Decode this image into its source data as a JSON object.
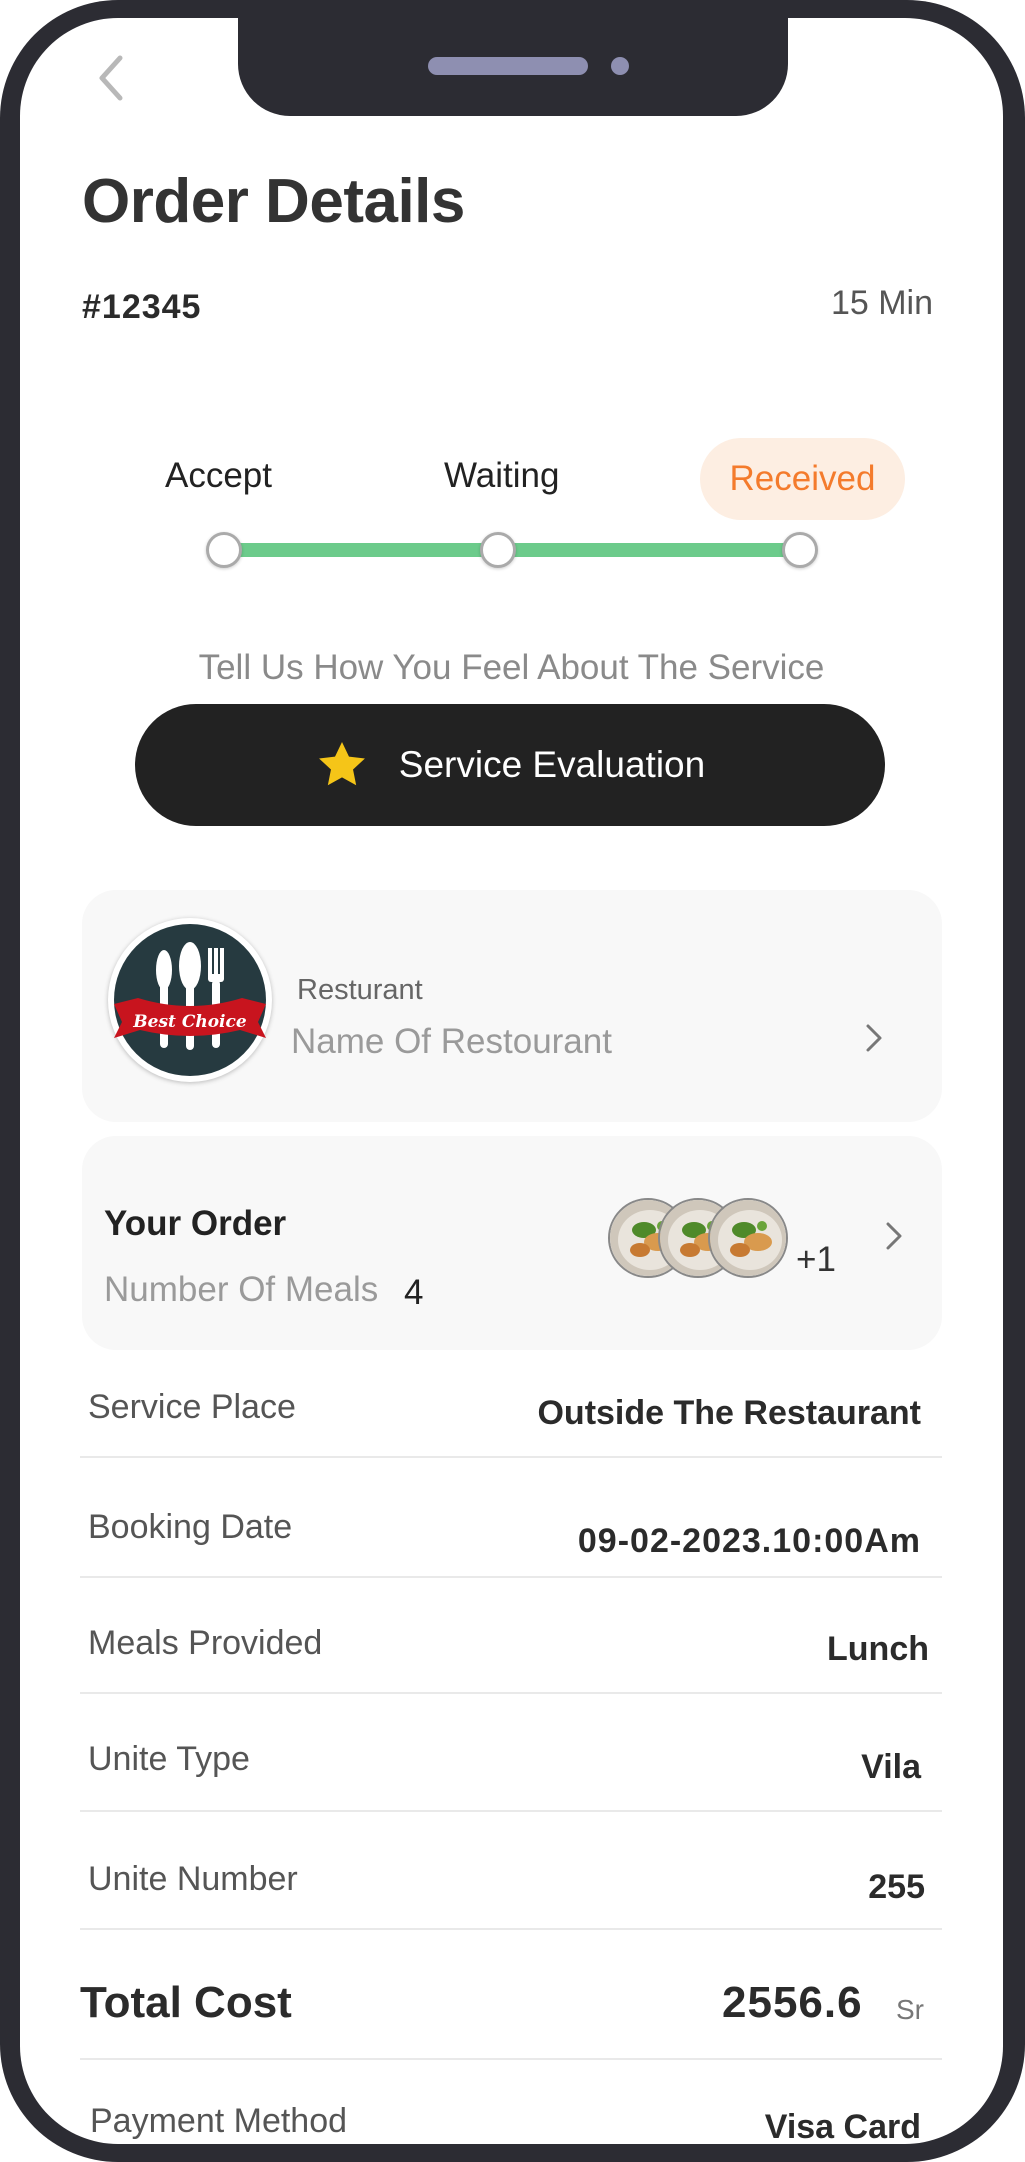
{
  "header": {
    "back_icon": "chevron-left-icon",
    "title": "Order Details",
    "order_id": "#12345",
    "eta": "15 Min"
  },
  "progress": {
    "steps": [
      {
        "label": "Accept",
        "state": "done"
      },
      {
        "label": "Waiting",
        "state": "done"
      },
      {
        "label": "Received",
        "state": "current"
      }
    ],
    "track_color": "#6ccb8b",
    "active_color": "#f47b2c",
    "completed_fraction": 1.0
  },
  "feedback": {
    "prompt": "Tell Us How You Feel About The Service",
    "button_label": "Service Evaluation",
    "button_icon": "star-icon"
  },
  "restaurant": {
    "label": "Resturant",
    "name": "Name Of Restourant",
    "logo_text": "Best Choice"
  },
  "order": {
    "title": "Your Order",
    "meals_label": "Number Of Meals",
    "meals_count": "4",
    "extra_count": "+1"
  },
  "details": [
    {
      "label": "Service Place",
      "value": "Outside The Restaurant"
    },
    {
      "label": "Booking Date",
      "value": "09-02-2023.10:00Am"
    },
    {
      "label": "Meals Provided",
      "value": "Lunch"
    },
    {
      "label": "Unite Type",
      "value": "Vila"
    },
    {
      "label": "Unite Number",
      "value": "255"
    }
  ],
  "total": {
    "label": "Total Cost",
    "value": "2556.6",
    "unit": "Sr"
  },
  "payment": {
    "label": "Payment Method",
    "value": "Visa Card"
  },
  "colors": {
    "primary_dark": "#222222",
    "accent_orange": "#f47b2c",
    "track_green": "#6ccb8b",
    "star_yellow": "#f5c518"
  }
}
